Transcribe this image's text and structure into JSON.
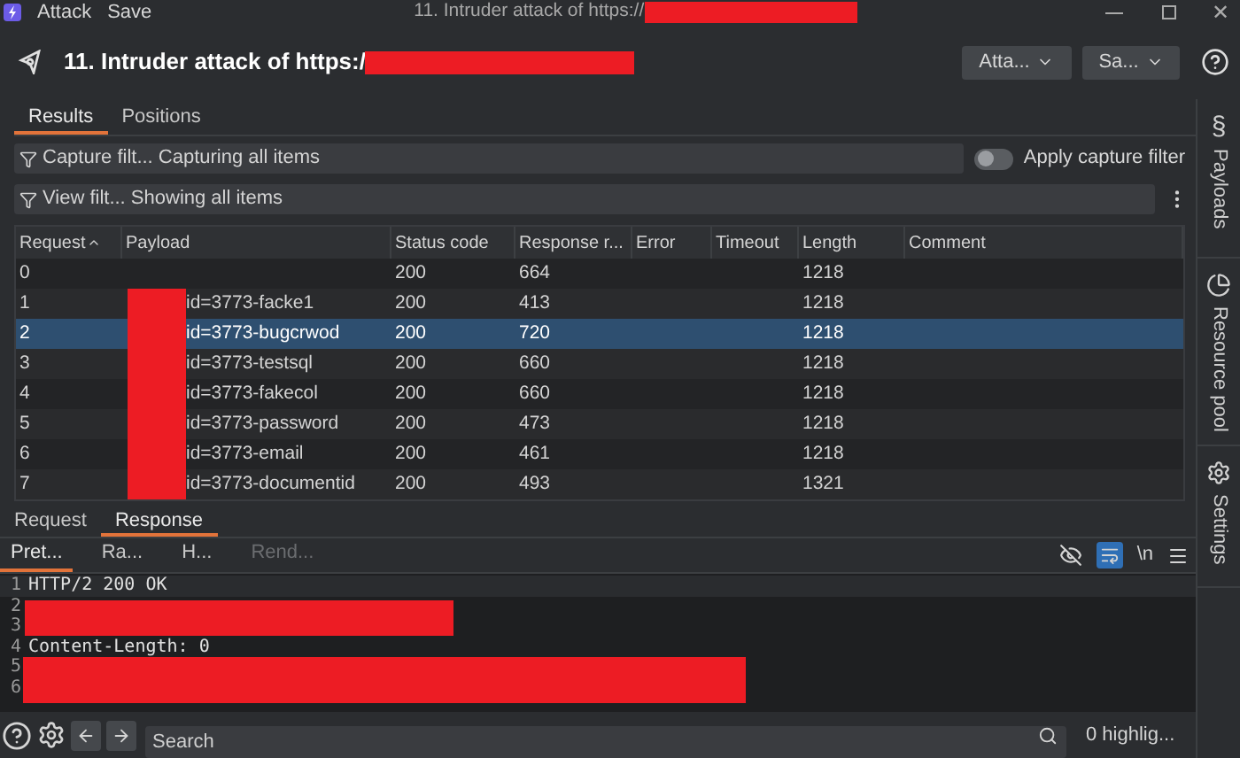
{
  "window": {
    "menu": [
      "Attack",
      "Save"
    ],
    "title": "11. Intruder attack of https://",
    "close": "✕"
  },
  "header": {
    "title": "11. Intruder attack of https:/",
    "buttons": [
      "Atta...",
      "Sa..."
    ]
  },
  "tabs": [
    {
      "label": "Results",
      "selected": true
    },
    {
      "label": "Positions",
      "selected": false
    }
  ],
  "capture_filter": {
    "label": "Capture filt... Capturing all items",
    "toggle_label": "Apply capture filter",
    "on": false
  },
  "view_filter": {
    "label": "View filt... Showing all items"
  },
  "table": {
    "columns": [
      "Request",
      "Payload",
      "Status code",
      "Response r...",
      "Error",
      "Timeout",
      "Length",
      "Comment"
    ],
    "rows": [
      {
        "request": "0",
        "redacted": false,
        "status": "200",
        "response": "664",
        "length": "1218",
        "selected": false
      },
      {
        "request": "1",
        "payload": "id=3773-facke1",
        "redacted": true,
        "status": "200",
        "response": "413",
        "length": "1218",
        "selected": false
      },
      {
        "request": "2",
        "payload": "id=3773-bugcrwod",
        "redacted": true,
        "status": "200",
        "response": "720",
        "length": "1218",
        "selected": true
      },
      {
        "request": "3",
        "payload": "id=3773-testsql",
        "redacted": true,
        "status": "200",
        "response": "660",
        "length": "1218",
        "selected": false
      },
      {
        "request": "4",
        "payload": "id=3773-fakecol",
        "redacted": true,
        "status": "200",
        "response": "660",
        "length": "1218",
        "selected": false
      },
      {
        "request": "5",
        "payload": "id=3773-password",
        "redacted": true,
        "status": "200",
        "response": "473",
        "length": "1218",
        "selected": false
      },
      {
        "request": "6",
        "payload": "id=3773-email",
        "redacted": true,
        "status": "200",
        "response": "461",
        "length": "1218",
        "selected": false
      },
      {
        "request": "7",
        "payload": "id=3773-documentid",
        "redacted": true,
        "status": "200",
        "response": "493",
        "length": "1321",
        "selected": false
      }
    ]
  },
  "message_tabs": [
    {
      "label": "Request",
      "selected": false
    },
    {
      "label": "Response",
      "selected": true
    }
  ],
  "view_tabs": [
    {
      "label": "Pret...",
      "selected": true,
      "disabled": false
    },
    {
      "label": "Ra...",
      "selected": false,
      "disabled": false
    },
    {
      "label": "H...",
      "selected": false,
      "disabled": false
    },
    {
      "label": "Rend...",
      "selected": false,
      "disabled": true
    }
  ],
  "toolbar": {
    "newline": "\\n",
    "wrap_on": true
  },
  "code_lines": [
    {
      "number": "1",
      "text": "HTTP/2 200 OK"
    },
    {
      "number": "2"
    },
    {
      "number": "3"
    },
    {
      "number": "4",
      "text": "Content-Length: 0"
    },
    {
      "number": "5"
    },
    {
      "number": "6"
    }
  ],
  "search": {
    "placeholder": "Search",
    "count": "0 highlig..."
  },
  "side_tabs": [
    {
      "label": "Payloads",
      "glyph": "§"
    },
    {
      "label": "Resource pool"
    },
    {
      "label": "Settings"
    }
  ]
}
